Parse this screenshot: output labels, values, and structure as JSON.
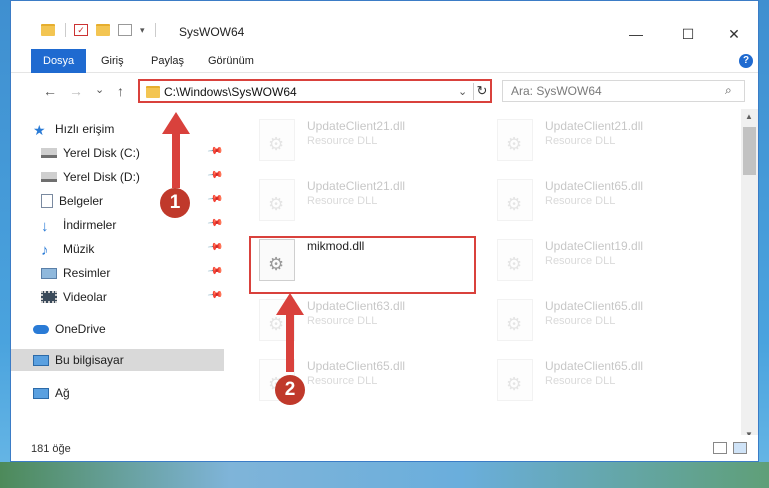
{
  "window": {
    "title": "SysWOW64",
    "controls": {
      "minimize": "—",
      "maximize": "☐",
      "close": "✕"
    }
  },
  "ribbon": {
    "tabs": [
      {
        "label": "Dosya",
        "active": true
      },
      {
        "label": "Giriş",
        "active": false
      },
      {
        "label": "Paylaş",
        "active": false
      },
      {
        "label": "Görünüm",
        "active": false
      }
    ],
    "help": "?"
  },
  "nav": {
    "back": "←",
    "forward": "→",
    "recent": "⌄",
    "up": "↑",
    "address": "C:\\Windows\\SysWOW64",
    "address_dropdown": "⌄",
    "refresh": "↻"
  },
  "search": {
    "placeholder": "Ara: SysWOW64",
    "icon": "⌕"
  },
  "sidebar": {
    "quick_access": "Hızlı erişim",
    "items": [
      {
        "label": "Yerel Disk (C:)",
        "icon": "drive-icon",
        "pinned": true
      },
      {
        "label": "Yerel Disk (D:)",
        "icon": "drive-icon",
        "pinned": true
      },
      {
        "label": "Belgeler",
        "icon": "documents-icon",
        "pinned": true
      },
      {
        "label": "İndirmeler",
        "icon": "download-icon",
        "pinned": true
      },
      {
        "label": "Müzik",
        "icon": "music-icon",
        "pinned": true
      },
      {
        "label": "Resimler",
        "icon": "pictures-icon",
        "pinned": true
      },
      {
        "label": "Videolar",
        "icon": "videos-icon",
        "pinned": true
      }
    ],
    "onedrive": "OneDrive",
    "this_pc": "Bu bilgisayar",
    "network": "Ağ"
  },
  "files": [
    {
      "name": "UpdateClient21.dll",
      "desc": "Resource DLL",
      "faded": true
    },
    {
      "name": "UpdateClient21.dll",
      "desc": "Resource DLL",
      "faded": true
    },
    {
      "name": "UpdateClient21.dll",
      "desc": "Resource DLL",
      "faded": true
    },
    {
      "name": "UpdateClient65.dll",
      "desc": "Resource DLL",
      "faded": true
    },
    {
      "name": "mikmod.dll",
      "desc": "",
      "faded": false
    },
    {
      "name": "UpdateClient19.dll",
      "desc": "Resource DLL",
      "faded": true
    },
    {
      "name": "UpdateClient63.dll",
      "desc": "Resource DLL",
      "faded": true
    },
    {
      "name": "UpdateClient65.dll",
      "desc": "Resource DLL",
      "faded": true
    },
    {
      "name": "UpdateClient65.dll",
      "desc": "Resource DLL",
      "faded": true
    },
    {
      "name": "UpdateClient65.dll",
      "desc": "Resource DLL",
      "faded": true
    }
  ],
  "status": {
    "count": "181 öğe"
  },
  "annotations": {
    "step1": "1",
    "step2": "2",
    "color": "#d9413c"
  }
}
